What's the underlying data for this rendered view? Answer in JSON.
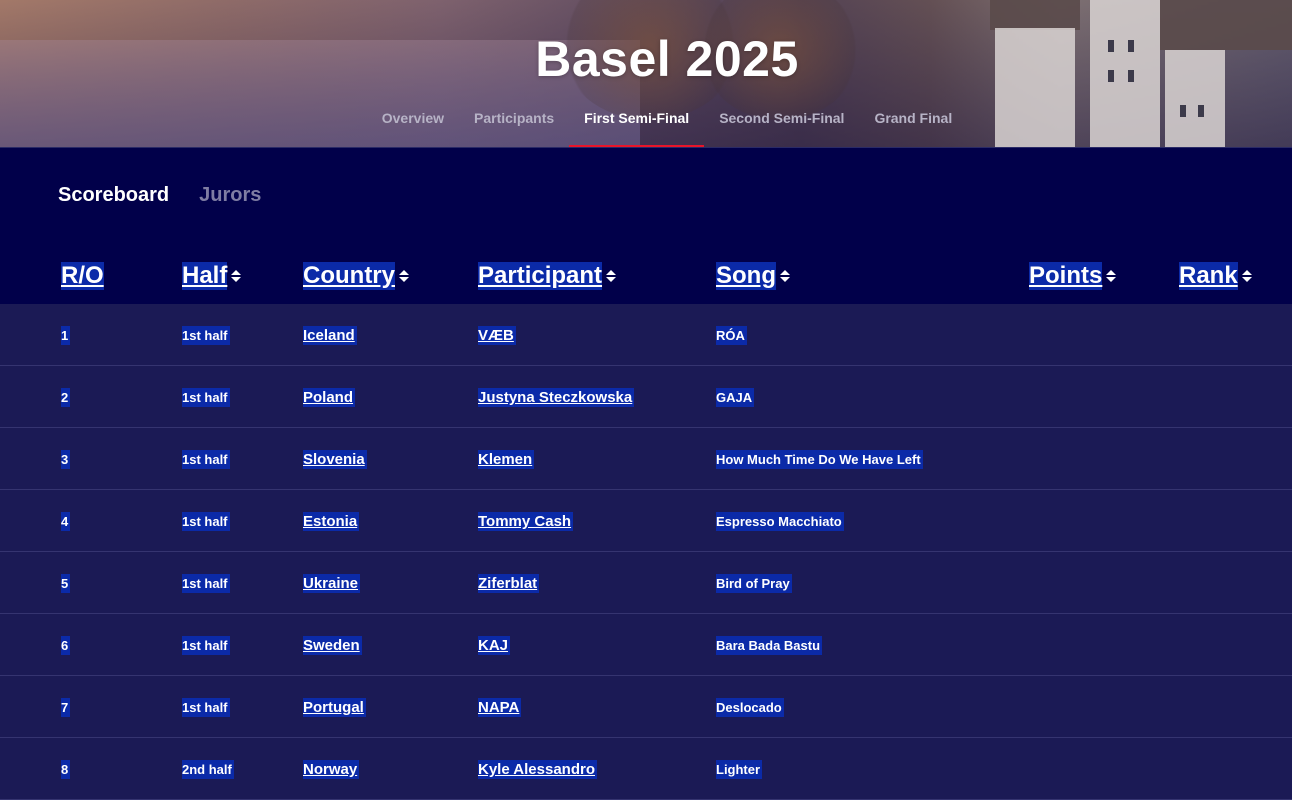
{
  "hero": {
    "title": "Basel 2025"
  },
  "nav": {
    "items": [
      {
        "label": "Overview",
        "active": false
      },
      {
        "label": "Participants",
        "active": false
      },
      {
        "label": "First Semi-Final",
        "active": true
      },
      {
        "label": "Second Semi-Final",
        "active": false
      },
      {
        "label": "Grand Final",
        "active": false
      }
    ],
    "active_indicator_color": "#e8152a"
  },
  "subtabs": [
    {
      "label": "Scoreboard",
      "active": true
    },
    {
      "label": "Jurors",
      "active": false
    }
  ],
  "table": {
    "columns": [
      {
        "label": "R/O",
        "sortable": false
      },
      {
        "label": "Half",
        "sortable": true
      },
      {
        "label": "Country",
        "sortable": true
      },
      {
        "label": "Participant",
        "sortable": true
      },
      {
        "label": "Song",
        "sortable": true
      },
      {
        "label": "Points",
        "sortable": true
      },
      {
        "label": "Rank",
        "sortable": true
      }
    ],
    "rows": [
      {
        "ro": "1",
        "half": "1st half",
        "country": "Iceland",
        "participant": "VÆB",
        "song": "RÓA",
        "points": "",
        "rank": ""
      },
      {
        "ro": "2",
        "half": "1st half",
        "country": "Poland",
        "participant": "Justyna Steczkowska",
        "song": "GAJA",
        "points": "",
        "rank": ""
      },
      {
        "ro": "3",
        "half": "1st half",
        "country": "Slovenia",
        "participant": "Klemen",
        "song": "How Much Time Do We Have Left",
        "points": "",
        "rank": ""
      },
      {
        "ro": "4",
        "half": "1st half",
        "country": "Estonia",
        "participant": "Tommy Cash",
        "song": "Espresso Macchiato",
        "points": "",
        "rank": ""
      },
      {
        "ro": "5",
        "half": "1st half",
        "country": "Ukraine",
        "participant": "Ziferblat",
        "song": "Bird of Pray",
        "points": "",
        "rank": ""
      },
      {
        "ro": "6",
        "half": "1st half",
        "country": "Sweden",
        "participant": "KAJ",
        "song": "Bara Bada Bastu",
        "points": "",
        "rank": ""
      },
      {
        "ro": "7",
        "half": "1st half",
        "country": "Portugal",
        "participant": "NAPA",
        "song": "Deslocado",
        "points": "",
        "rank": ""
      },
      {
        "ro": "8",
        "half": "2nd half",
        "country": "Norway",
        "participant": "Kyle Alessandro",
        "song": "Lighter",
        "points": "",
        "rank": ""
      }
    ]
  },
  "colors": {
    "page_background": "#01004a",
    "row_background": "#1b1a55",
    "selection_highlight": "#0b2aa8"
  }
}
